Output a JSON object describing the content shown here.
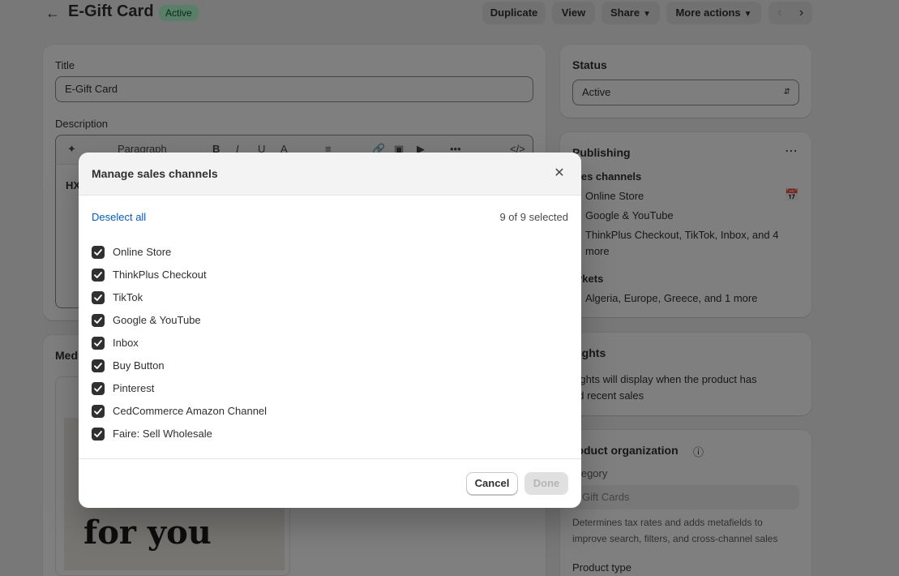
{
  "header": {
    "title": "E-Gift Card",
    "status_badge": "Active",
    "buttons": {
      "duplicate": "Duplicate",
      "view": "View",
      "share": "Share",
      "more_actions": "More actions"
    }
  },
  "product": {
    "title_label": "Title",
    "title_value": "E-Gift Card",
    "description_label": "Description",
    "toolbar": {
      "paragraph": "Paragraph",
      "bold": "B",
      "italic": "I",
      "underline": "U",
      "color": "A",
      "more": "•••"
    },
    "description_preview": "HX",
    "media_label": "Med",
    "media_image_text": "for you"
  },
  "status_card": {
    "heading": "Status",
    "value": "Active"
  },
  "publishing_card": {
    "heading": "Publishing",
    "sales_channels_label": "ales channels",
    "channels": [
      "Online Store",
      "Google & YouTube",
      "ThinkPlus Checkout, TikTok, Inbox, and 4",
      "more"
    ],
    "markets_label": "arkets",
    "markets_value": "Algeria, Europe, Greece, and 1 more"
  },
  "insights_card": {
    "heading": "sights",
    "line1": "sights will display when the product has",
    "line2": "ad recent sales"
  },
  "organization_card": {
    "heading": "roduct organization",
    "category_label": "ategory",
    "category_value": "Gift Cards",
    "help_line1": "Determines tax rates and adds metafields to",
    "help_line2": "improve search, filters, and cross-channel sales",
    "product_type_label": "Product type"
  },
  "modal": {
    "title": "Manage sales channels",
    "deselect_all": "Deselect all",
    "selected_count": "9 of 9 selected",
    "channels": [
      {
        "label": "Online Store",
        "checked": true
      },
      {
        "label": "ThinkPlus Checkout",
        "checked": true
      },
      {
        "label": "TikTok",
        "checked": true
      },
      {
        "label": "Google & YouTube",
        "checked": true
      },
      {
        "label": "Inbox",
        "checked": true
      },
      {
        "label": "Buy Button",
        "checked": true
      },
      {
        "label": "Pinterest",
        "checked": true
      },
      {
        "label": "CedCommerce Amazon Channel",
        "checked": true
      },
      {
        "label": "Faire: Sell Wholesale",
        "checked": true
      }
    ],
    "cancel_label": "Cancel",
    "done_label": "Done"
  }
}
